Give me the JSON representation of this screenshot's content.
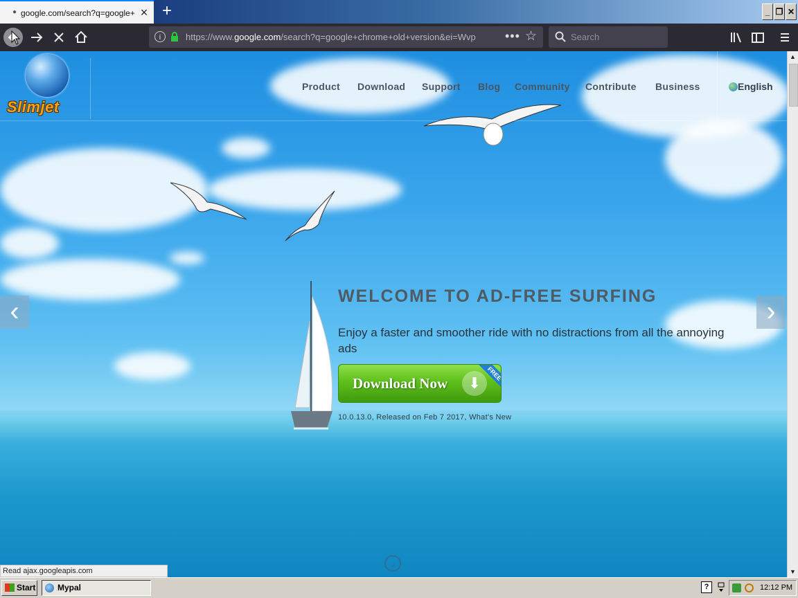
{
  "tab": {
    "title": "google.com/search?q=google+chr"
  },
  "window_controls": {
    "minimize": "_",
    "restore": "❐",
    "close": "✕"
  },
  "url": {
    "prefix": "https://www.",
    "domain": "google.com",
    "rest": "/search?q=google+chrome+old+version&ei=Wvp"
  },
  "search": {
    "placeholder": "Search"
  },
  "site": {
    "logo_text": "Slimjet",
    "menu": [
      "Product",
      "Download",
      "Support",
      "Blog",
      "Community",
      "Contribute",
      "Business"
    ],
    "language": "English",
    "headline": "WELCOME TO AD-FREE SURFING",
    "subline": "Enjoy a faster and smoother ride with no distractions from all the annoying ads",
    "download_label": "Download Now",
    "free_badge": "FREE",
    "version_info": "10.0.13.0, Released on Feb 7 2017, What's New"
  },
  "status": {
    "text": "Read ajax.googleapis.com"
  },
  "taskbar": {
    "start_label": "Start",
    "window_label": "Mypal",
    "clock": "12:12 PM",
    "help": "?"
  },
  "colors": {
    "headline": "#4f5a63",
    "download_green": "#5fbf1c",
    "firefox_dark": "#2b2a33",
    "accent": "#0a84ff"
  }
}
